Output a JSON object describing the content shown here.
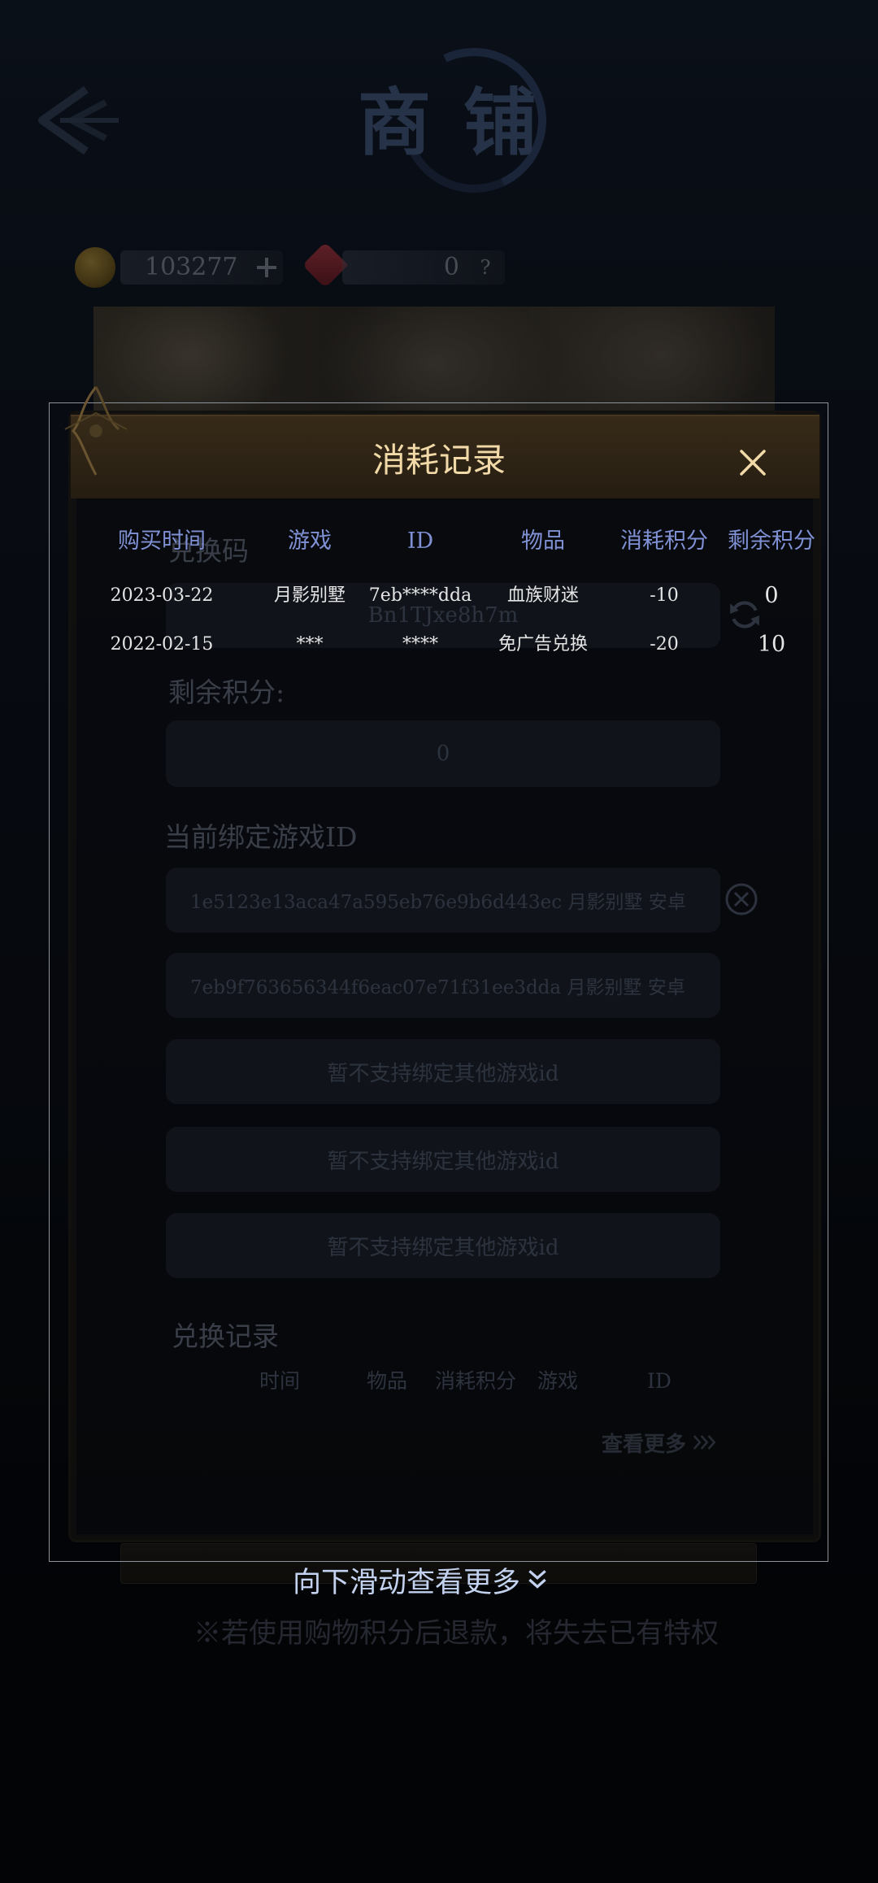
{
  "header": {
    "logo_text": "商铺"
  },
  "currency": {
    "coins": "103277",
    "gems": "0",
    "gem_help": "?"
  },
  "panel": {
    "redeem_label": "兑换码",
    "redeem_value": "Bn1TJxe8h7m",
    "remaining_label": "剩余积分:",
    "remaining_value": "0",
    "bound_label": "当前绑定游戏ID",
    "bound_ids": [
      "1e5123e13aca47a595eb76e9b6d443ec 月影别墅 安卓",
      "7eb9f763656344f6eac07e71f31ee3dda 月影别墅 安卓"
    ],
    "unsupported": [
      "暂不支持绑定其他游戏id",
      "暂不支持绑定其他游戏id",
      "暂不支持绑定其他游戏id"
    ],
    "history_title": "兑换记录",
    "history_headers": [
      "时间",
      "物品",
      "消耗积分",
      "游戏",
      "ID"
    ],
    "view_more": "查看更多"
  },
  "modal": {
    "title": "消耗记录",
    "headers": [
      "购买时间",
      "游戏",
      "ID",
      "物品",
      "消耗积分",
      "剩余积分"
    ],
    "rows": [
      {
        "time": "2023-03-22",
        "game": "月影别墅",
        "id": "7eb****dda",
        "item": "血族财迷",
        "cost": "-10",
        "balance": "0"
      },
      {
        "time": "2022-02-15",
        "game": "***",
        "id": "****",
        "item": "免广告兑换",
        "cost": "-20",
        "balance": "10"
      }
    ]
  },
  "footer": {
    "scroll_hint": "向下滑动查看更多",
    "notice": "※若使用购物积分后退款，将失去已有特权"
  },
  "colors": {
    "modal_title": "#f2d9a8",
    "table_header": "#7f91d4",
    "table_text": "#e5e5e5",
    "scroll_hint": "#c2d2ef"
  },
  "icons": [
    "back-arrow-icon",
    "coin-icon",
    "plus-icon",
    "gem-icon",
    "refresh-icon",
    "close-circle-icon",
    "triple-chevron-right-icon",
    "close-icon",
    "double-chevron-down-icon"
  ]
}
